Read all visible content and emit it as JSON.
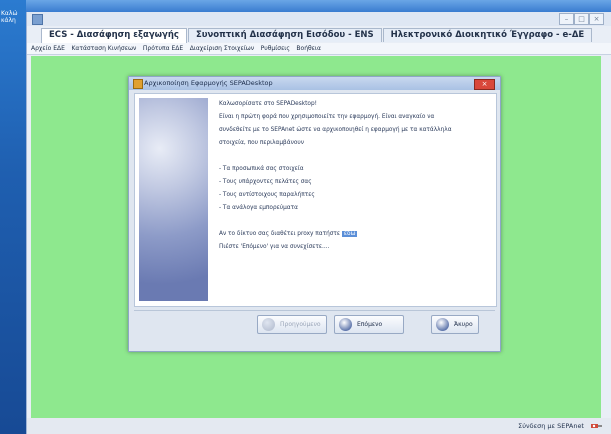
{
  "desktop": {
    "text": "Καλώ\nκάλη"
  },
  "app": {
    "tabs": [
      {
        "label": "ECS - Διασάφηση εξαγωγής"
      },
      {
        "label": "Συνοπτική Διασάφηση Εισόδου - ENS"
      },
      {
        "label": "Ηλεκτρονικό Διοικητικό Έγγραφο - e-ΔΕ"
      }
    ],
    "menu": [
      "Αρχείο ΕΔΕ",
      "Κατάσταση Κινήσεων",
      "Πρότυπα ΕΔΕ",
      "Διαχείριση Στοιχείων",
      "Ρυθμίσεις",
      "Βοήθεια"
    ],
    "status": "Σύνδεση με SEPAnet"
  },
  "dialog": {
    "title": "Αρχικοποίηση Εφαρμογής SEPADesktop",
    "welcome": "Καλωσορίσατε στο SEPADesktop!",
    "intro_1": "Είναι η πρώτη φορά που χρησιμοποιείτε την εφαρμογή. Είναι αναγκαίο να",
    "intro_2": "συνδεθείτε με το SEPAnet ώστε να αρχικοποιηθεί η εφαρμογή με τα κατάλληλα",
    "intro_3": "στοιχεία, που περιλαμβάνουν",
    "items": [
      "- Τα προσωπικά σας στοιχεία",
      "- Τους υπάρχοντες πελάτες σας",
      "- Τους αντίστοιχους παραλήπτες",
      "- Τα ανάλογα εμπορεύματα"
    ],
    "proxy_text": "Αν το δίκτυο σας διαθέτει proxy πατήστε",
    "proxy_link": "εδώ",
    "next_text": "Πιέστε 'Επόμενο' για να συνεχίσετε....",
    "buttons": {
      "prev": "Προηγούμενο",
      "next": "Επόμενο",
      "cancel": "Άκυρο"
    }
  }
}
